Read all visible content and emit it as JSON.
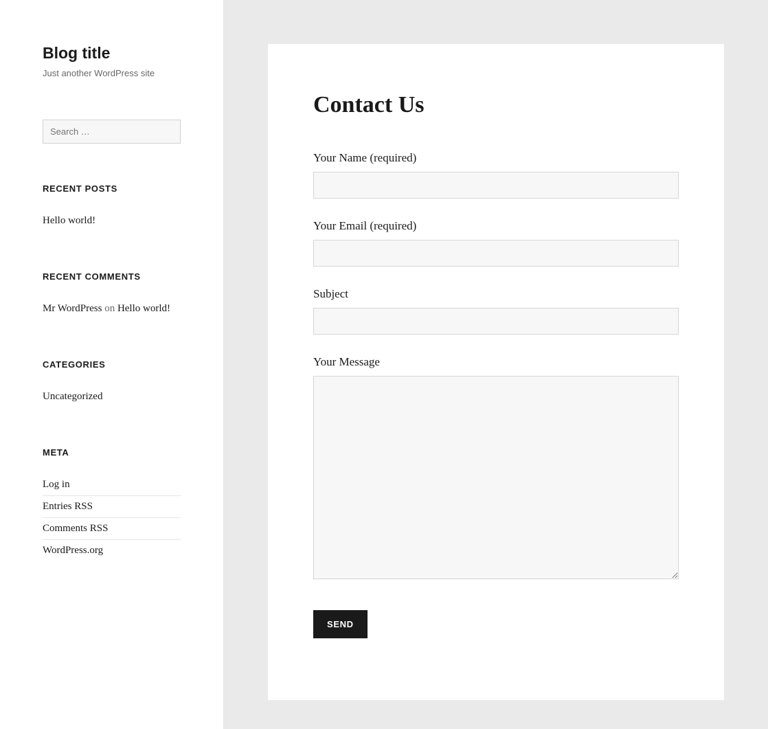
{
  "sidebar": {
    "title": "Blog title",
    "tagline": "Just another WordPress site",
    "search_placeholder": "Search …",
    "recent_posts": {
      "heading": "RECENT POSTS",
      "items": [
        "Hello world!"
      ]
    },
    "recent_comments": {
      "heading": "RECENT COMMENTS",
      "author": "Mr WordPress",
      "on": " on ",
      "post": "Hello world!"
    },
    "categories": {
      "heading": "CATEGORIES",
      "items": [
        "Uncategorized"
      ]
    },
    "meta": {
      "heading": "META",
      "items": [
        "Log in",
        "Entries RSS",
        "Comments RSS",
        "WordPress.org"
      ]
    }
  },
  "main": {
    "title": "Contact Us",
    "form": {
      "name_label": "Your Name (required)",
      "email_label": "Your Email (required)",
      "subject_label": "Subject",
      "message_label": "Your Message",
      "send_label": "Send"
    }
  }
}
